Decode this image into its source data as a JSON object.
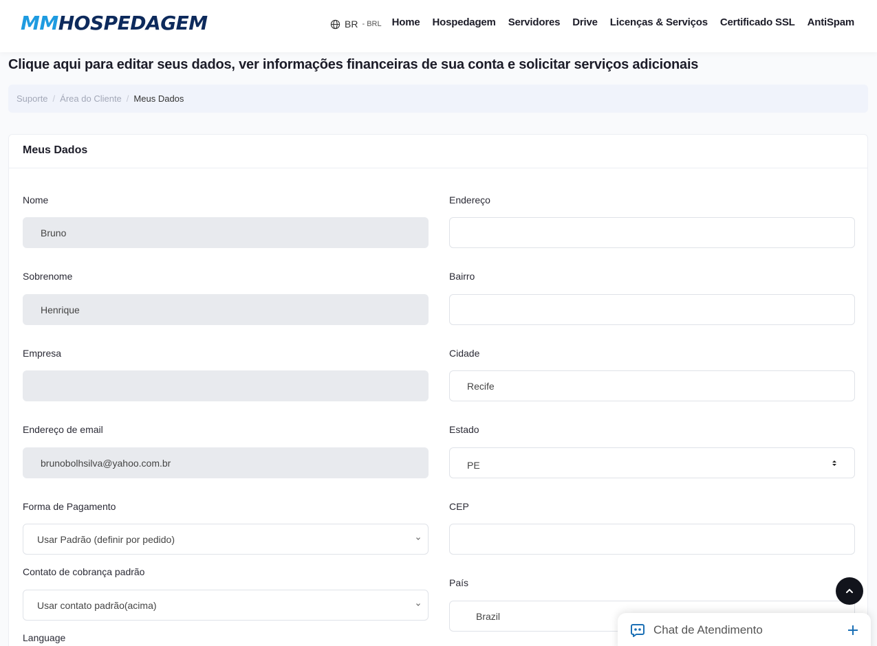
{
  "header": {
    "logo": {
      "part1": "MM",
      "part2": "HOSPEDAGEM"
    },
    "language": {
      "code": "BR",
      "separator": "-",
      "currency": "BRL"
    },
    "nav": [
      "Home",
      "Hospedagem",
      "Servidores",
      "Drive",
      "Licenças & Serviços",
      "Certificado SSL",
      "AntiSpam"
    ]
  },
  "page": {
    "title": "Clique aqui para editar seus dados, ver informações financeiras de sua conta e solicitar serviços adicionais",
    "breadcrumb": [
      "Suporte",
      "Área do Cliente",
      "Meus Dados"
    ]
  },
  "card": {
    "title": "Meus Dados"
  },
  "form": {
    "nome": {
      "label": "Nome",
      "value": "Bruno"
    },
    "sobrenome": {
      "label": "Sobrenome",
      "value": "Henrique"
    },
    "empresa": {
      "label": "Empresa",
      "value": ""
    },
    "email": {
      "label": "Endereço de email",
      "value": "brunobolhsilva@yahoo.com.br"
    },
    "forma_pagamento": {
      "label": "Forma de Pagamento",
      "value": "Usar Padrão (definir por pedido)"
    },
    "contato_cobranca": {
      "label": "Contato de cobrança padrão",
      "value": "Usar contato padrão(acima)"
    },
    "language": {
      "label": "Language"
    },
    "endereco": {
      "label": "Endereço",
      "value": ""
    },
    "bairro": {
      "label": "Bairro",
      "value": ""
    },
    "cidade": {
      "label": "Cidade",
      "value": "Recife"
    },
    "estado": {
      "label": "Estado",
      "value": "PE"
    },
    "cep": {
      "label": "CEP",
      "value": ""
    },
    "pais": {
      "label": "País",
      "value": "Brazil"
    }
  },
  "chat": {
    "label": "Chat de Atendimento"
  },
  "colors": {
    "logo_light": "#1e9be0",
    "logo_dark": "#0d2a5c",
    "breadcrumb_bg": "#f0f3fb",
    "disabled_input": "#e8eaee",
    "chat_icon": "#1a6fb5"
  }
}
